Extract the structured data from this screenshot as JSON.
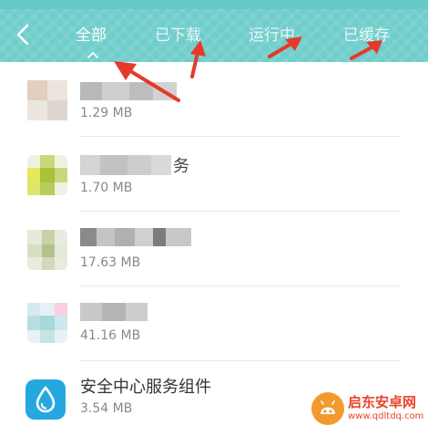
{
  "header": {
    "back_icon": "chevron-left-icon",
    "tabs": [
      {
        "label": "全部",
        "active": true
      },
      {
        "label": "已下载",
        "active": false
      },
      {
        "label": "运行中",
        "active": false
      },
      {
        "label": "已缓存",
        "active": false
      }
    ]
  },
  "apps": [
    {
      "name": "",
      "size": "1.29 MB",
      "name_obscured": true
    },
    {
      "name": "务",
      "size": "1.70 MB",
      "name_obscured": true
    },
    {
      "name": "",
      "size": "17.63 MB",
      "name_obscured": true
    },
    {
      "name": "",
      "size": "41.16 MB",
      "name_obscured": true
    },
    {
      "name": "安全中心服务组件",
      "size": "3.54 MB",
      "name_obscured": false,
      "icon": "water-drop-icon"
    }
  ],
  "watermark": {
    "title": "启东安卓网",
    "url": "www.qdltdq.com"
  },
  "colors": {
    "header": "#6fcdca",
    "annotation_arrow": "#e53a2a",
    "security_icon": "#25a8e0"
  }
}
